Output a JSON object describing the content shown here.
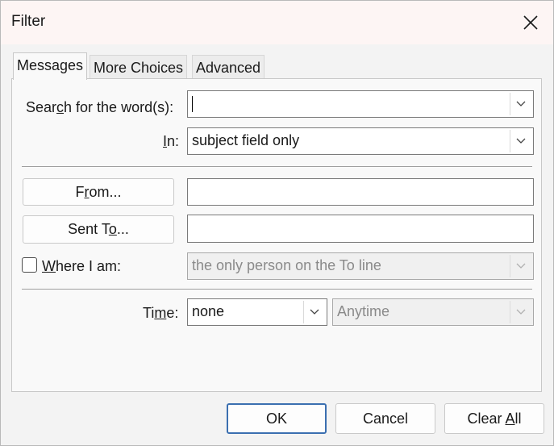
{
  "dialog": {
    "title": "Filter",
    "close_icon": "close-icon"
  },
  "tabs": [
    {
      "label": "Messages",
      "active": true
    },
    {
      "label": "More Choices",
      "active": false
    },
    {
      "label": "Advanced",
      "active": false
    }
  ],
  "messages": {
    "search_label": {
      "pre": "Sear",
      "u": "c",
      "post": "h for the word(s):"
    },
    "search_value": "",
    "in_label": {
      "pre": "",
      "u": "I",
      "post": "n:"
    },
    "in_value": "subject field only",
    "from_button": {
      "pre": "F",
      "u": "r",
      "post": "om..."
    },
    "from_value": "",
    "sent_to_button": {
      "pre": "Sent T",
      "u": "o",
      "post": "..."
    },
    "sent_to_value": "",
    "where_label": {
      "pre": "",
      "u": "W",
      "post": "here I am:"
    },
    "where_checked": false,
    "where_value": "the only person on the To line",
    "time_label": {
      "pre": "Ti",
      "u": "m",
      "post": "e:"
    },
    "time_value": "none",
    "time_range_value": "Anytime"
  },
  "footer": {
    "ok_label": "OK",
    "cancel_label": "Cancel",
    "clear_all": {
      "pre": "Clear ",
      "u": "A",
      "post": "ll"
    }
  },
  "icons": {
    "dropdown": "chevron-down-icon",
    "close": "close-icon"
  }
}
